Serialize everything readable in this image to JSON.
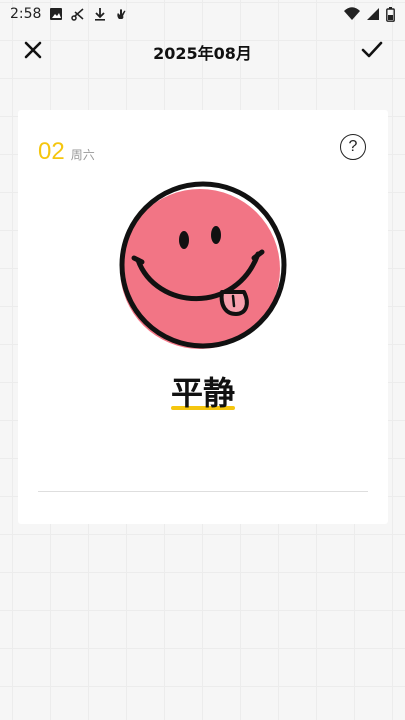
{
  "status_bar": {
    "time": "2:58",
    "icons": [
      "image-icon",
      "scissors-icon",
      "download-icon",
      "hand-icon"
    ],
    "right_icons": [
      "wifi-icon",
      "signal-icon",
      "battery-icon"
    ]
  },
  "header": {
    "title": "2025年08月",
    "close_icon": "close-icon",
    "confirm_icon": "check-icon"
  },
  "card": {
    "day": "02",
    "weekday": "周六",
    "help_label": "?",
    "mood_icon": "tongue-out-smiley-icon",
    "mood": "平静"
  },
  "colors": {
    "accent": "#f5c60f",
    "face_fill": "#f27585",
    "background": "#f6f6f6"
  }
}
